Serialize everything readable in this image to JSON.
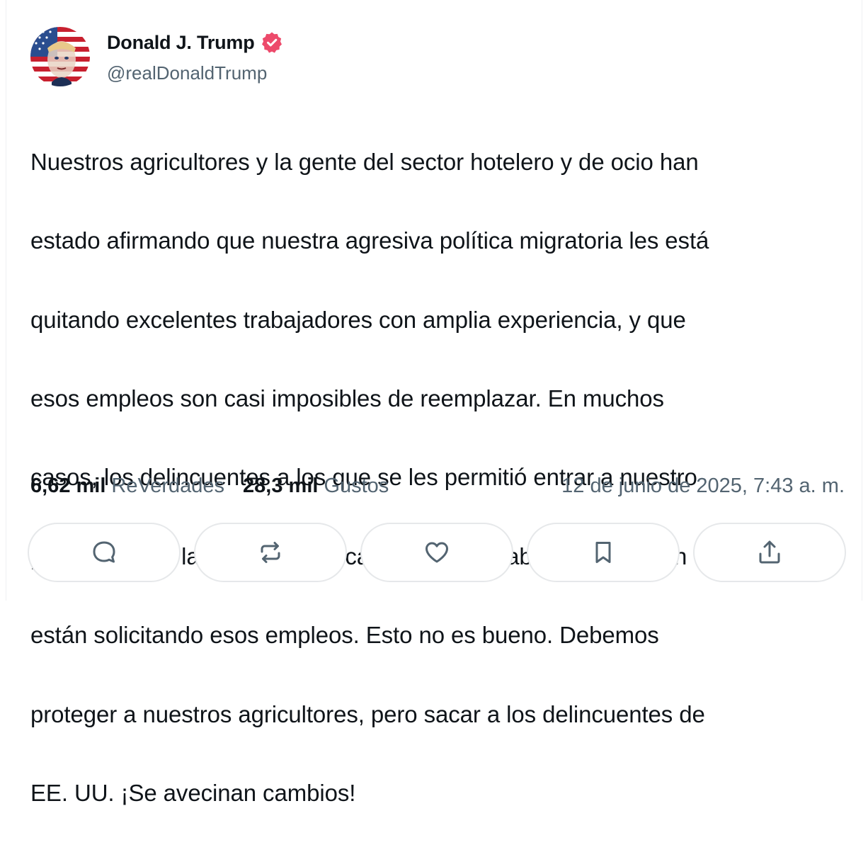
{
  "author": {
    "display_name": "Donald J. Trump",
    "handle": "@realDonaldTrump",
    "verified": true,
    "verified_color": "#ed4a6b"
  },
  "post": {
    "lines": [
      "Nuestros agricultores y la gente del sector hotelero y de ocio han",
      "estado afirmando que nuestra agresiva política migratoria les está",
      "quitando excelentes trabajadores con amplia experiencia, y que",
      "esos empleos son casi imposibles de reemplazar. En muchos",
      "casos, los delincuentes a los que se les permitió entrar a nuestro",
      "país gracias a la absurda política de fronteras abiertas de Biden",
      "están solicitando esos empleos. Esto no es bueno. Debemos",
      "proteger a nuestros agricultores, pero sacar a los delincuentes de",
      "EE. UU. ¡Se avecinan cambios!"
    ]
  },
  "stats": {
    "reposts_count": "6,62 mil",
    "reposts_label": "ReVerdades",
    "likes_count": "28,3 mil",
    "likes_label": "Gustos",
    "timestamp": "12 de junio de 2025, 7:43 a. m."
  },
  "actions": [
    {
      "icon": "reply-icon"
    },
    {
      "icon": "repost-icon"
    },
    {
      "icon": "heart-icon"
    },
    {
      "icon": "bookmark-icon"
    },
    {
      "icon": "share-icon"
    }
  ],
  "colors": {
    "text_primary": "#0f1419",
    "text_secondary": "#536471",
    "border": "#e6e8ea",
    "avatar_red": "#c8202f",
    "avatar_blue": "#2a4d8f"
  }
}
